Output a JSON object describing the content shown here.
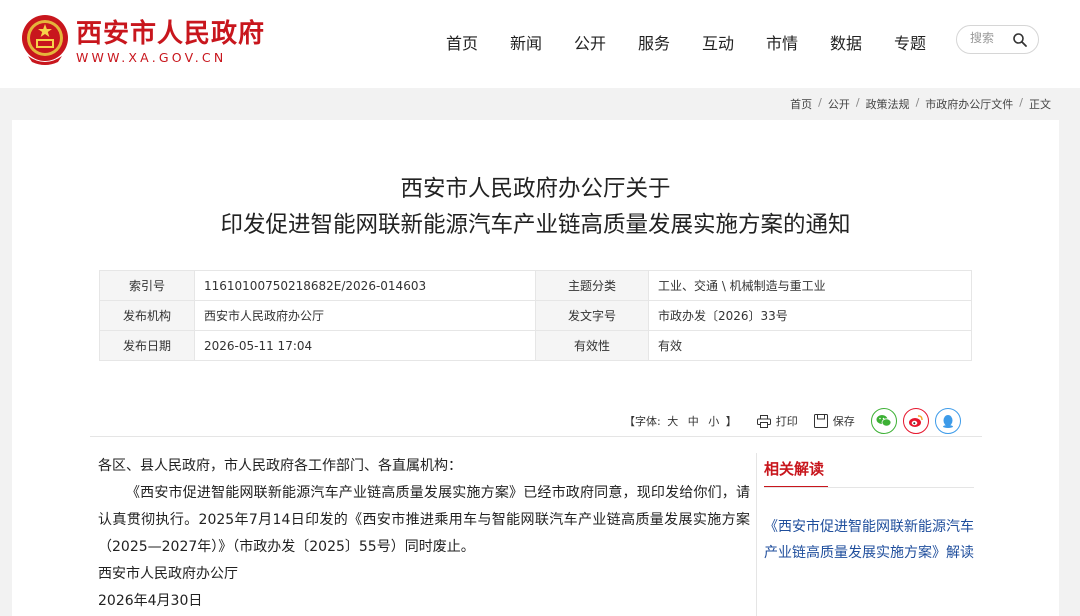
{
  "header": {
    "logo_cn": "西安市人民政府",
    "logo_en": "WWW.XA.GOV.CN",
    "nav": [
      "首页",
      "新闻",
      "公开",
      "服务",
      "互动",
      "市情",
      "数据",
      "专题"
    ],
    "search_placeholder": "搜索"
  },
  "breadcrumb": {
    "items": [
      "首页",
      "公开",
      "政策法规",
      "市政府办公厅文件"
    ],
    "current": "正文",
    "separator": "/"
  },
  "article": {
    "title_line1": "西安市人民政府办公厅关于",
    "title_line2": "印发促进智能网联新能源汽车产业链高质量发展实施方案的通知",
    "info": {
      "index_label": "索引号",
      "index_value": "11610100750218682E/2026-014603",
      "topic_label": "主题分类",
      "topic_value": "工业、交通 \\ 机械制造与重工业",
      "org_label": "发布机构",
      "org_value": "西安市人民政府办公厅",
      "docno_label": "发文字号",
      "docno_value": "市政办发〔2026〕33号",
      "date_label": "发布日期",
      "date_value": "2026-05-11 17:04",
      "validity_label": "有效性",
      "validity_value": "有效"
    },
    "tools": {
      "font_label": "【字体:",
      "font_large": "大",
      "font_medium": "中",
      "font_small": "小",
      "font_close": "】",
      "print": "打印",
      "save": "保存"
    },
    "body": {
      "salutation": "各区、县人民政府，市人民政府各工作部门、各直属机构：",
      "paragraph": "《西安市促进智能网联新能源汽车产业链高质量发展实施方案》已经市政府同意，现印发给你们，请认真贯彻执行。2025年7月14日印发的《西安市推进乘用车与智能网联汽车产业链高质量发展实施方案（2025—2027年）》（市政办发〔2025〕55号）同时废止。",
      "signer": "西安市人民政府办公厅",
      "sign_date": "2026年4月30日"
    }
  },
  "related": {
    "title": "相关解读",
    "link": "《西安市促进智能网联新能源汽车产业链高质量发展实施方案》解读"
  },
  "colors": {
    "brand_red": "#c8161d",
    "link_blue": "#1f4e9c",
    "wechat": "#3cb034",
    "weibo": "#e6162d",
    "qq": "#3d9be9"
  },
  "icons": [
    "national-emblem-icon",
    "search-icon",
    "print-icon",
    "save-icon",
    "wechat-icon",
    "weibo-icon",
    "qq-icon"
  ]
}
